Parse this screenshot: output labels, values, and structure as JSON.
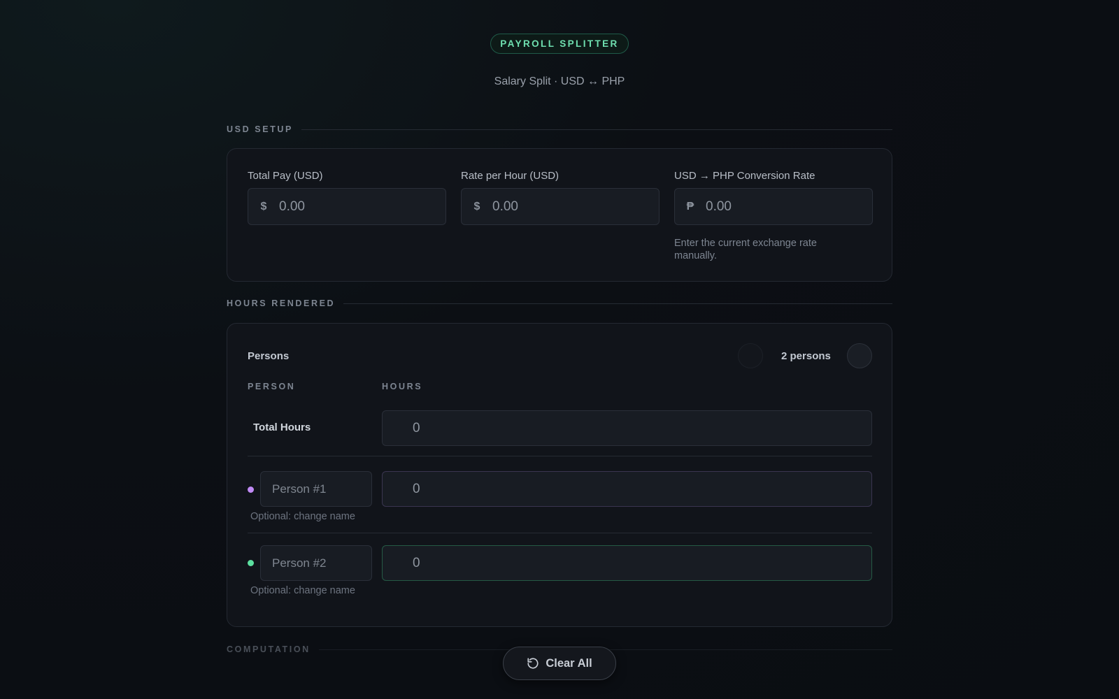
{
  "header": {
    "badge": "PAYROLL SPLITTER",
    "subtitle": "Salary Split · USD ↔ PHP"
  },
  "usd_setup": {
    "section_label": "USD SETUP",
    "total_pay": {
      "label": "Total Pay (USD)",
      "prefix": "$",
      "placeholder": "0.00"
    },
    "rate_per_hour": {
      "label": "Rate per Hour (USD)",
      "prefix": "$",
      "placeholder": "0.00"
    },
    "conversion_rate": {
      "label": "USD → PHP Conversion Rate",
      "prefix": "₱",
      "placeholder": "0.00",
      "hint": "Enter the current exchange rate manually."
    }
  },
  "hours": {
    "section_label": "HOURS RENDERED",
    "persons_title": "Persons",
    "person_count": "2 persons",
    "col_person": "PERSON",
    "col_hours": "HOURS",
    "total_label": "Total Hours",
    "total_value": "0",
    "people": [
      {
        "name_placeholder": "Person #1",
        "hours": "0",
        "hint": "Optional: change name",
        "color": "#c08af5"
      },
      {
        "name_placeholder": "Person #2",
        "hours": "0",
        "hint": "Optional: change name",
        "color": "#5ce0a0"
      }
    ]
  },
  "computation": {
    "section_label": "COMPUTATION"
  },
  "actions": {
    "clear_label": "Clear All"
  },
  "colors": {
    "accent": "#6fe0b0",
    "background": "#0c0f14",
    "card": "#11141a"
  }
}
